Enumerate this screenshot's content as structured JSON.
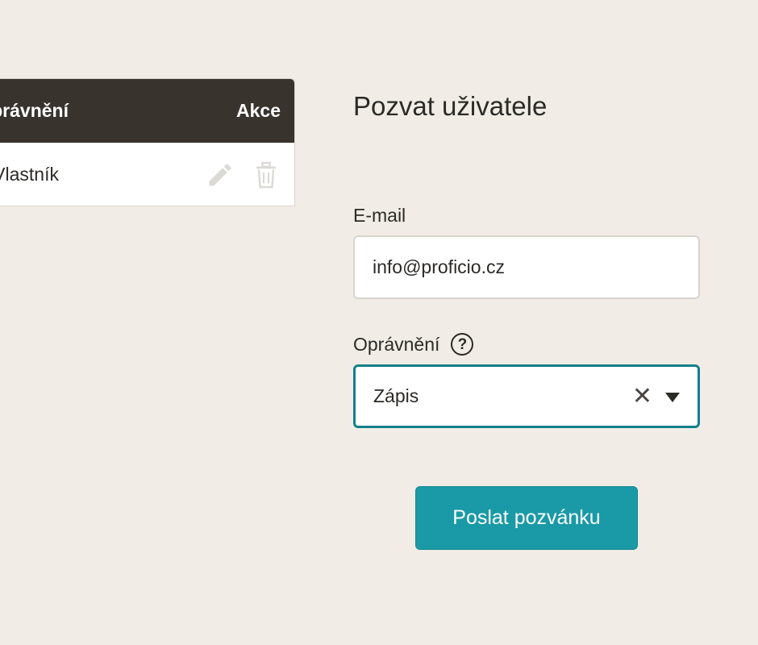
{
  "table": {
    "header": {
      "permission_label": "Oprávnění",
      "actions_label": "Akce"
    },
    "rows": [
      {
        "permission": "Vlastník",
        "actions": [
          "pencil-icon",
          "trash-icon"
        ]
      }
    ]
  },
  "invite_form": {
    "title": "Pozvat uživatele",
    "email": {
      "label": "E-mail",
      "value": "info@proficio.cz"
    },
    "permission": {
      "label": "Oprávnění",
      "help_icon": "question-circle-icon",
      "help_glyph": "?",
      "selected": "Zápis",
      "clear_glyph": "✕"
    },
    "submit_label": "Poslat pozvánku"
  },
  "colors": {
    "background": "#f1ede6",
    "table_header": "#38332d",
    "accent": "#1a9aa6",
    "focus_border": "#13808c"
  }
}
